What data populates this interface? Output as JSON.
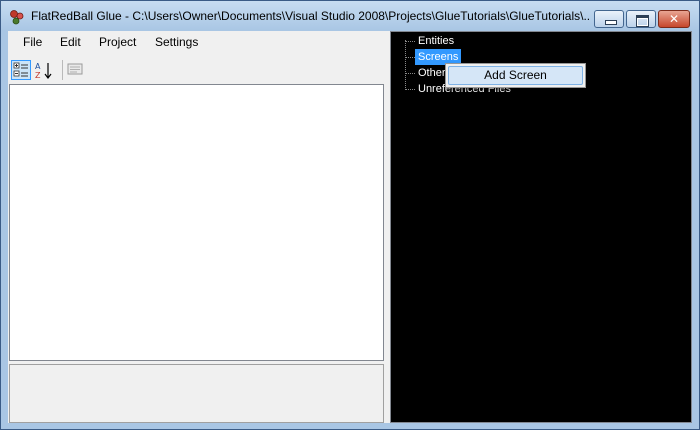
{
  "window": {
    "title": "FlatRedBall Glue - C:\\Users\\Owner\\Documents\\Visual Studio 2008\\Projects\\GlueTutorials\\GlueTutorials\\...",
    "icon": "flatredball-app-icon"
  },
  "menu": {
    "items": [
      "File",
      "Edit",
      "Project",
      "Settings"
    ]
  },
  "toolbar": {
    "buttons": [
      {
        "name": "categorized-view-icon",
        "active": true
      },
      {
        "name": "alphabetical-sort-icon",
        "active": false
      },
      {
        "name": "property-pages-icon",
        "active": false
      }
    ]
  },
  "tree": {
    "nodes": [
      "Entities",
      "Screens",
      "Other C",
      "Unreferenced Files"
    ],
    "selected": "Screens"
  },
  "context_menu": {
    "items": [
      "Add Screen"
    ]
  },
  "colors": {
    "selection": "#3399ff",
    "tree_background": "#000000"
  }
}
